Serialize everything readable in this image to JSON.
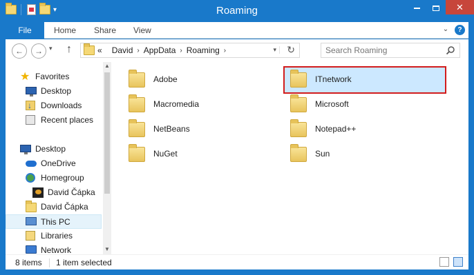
{
  "window": {
    "title": "Roaming"
  },
  "ribbon": {
    "tabs": [
      "File",
      "Home",
      "Share",
      "View"
    ],
    "help": "?"
  },
  "address": {
    "overflow": "«",
    "crumbs": [
      "David",
      "AppData",
      "Roaming"
    ]
  },
  "search": {
    "placeholder": "Search Roaming"
  },
  "navpane": {
    "favorites": [
      "Favorites",
      "Desktop",
      "Downloads",
      "Recent places"
    ],
    "tree": [
      "Desktop",
      "OneDrive",
      "Homegroup",
      "David Čápka",
      "David Čápka",
      "This PC",
      "Libraries",
      "Network"
    ],
    "selected": "This PC"
  },
  "files": [
    {
      "name": "Adobe",
      "selected": false
    },
    {
      "name": "ITnetwork",
      "selected": true
    },
    {
      "name": "Macromedia",
      "selected": false
    },
    {
      "name": "Microsoft",
      "selected": false
    },
    {
      "name": "NetBeans",
      "selected": false
    },
    {
      "name": "Notepad++",
      "selected": false
    },
    {
      "name": "NuGet",
      "selected": false
    },
    {
      "name": "Sun",
      "selected": false
    }
  ],
  "status": {
    "count": "8 items",
    "selection": "1 item selected"
  },
  "colors": {
    "accent": "#1979ca",
    "selection": "#cce8ff",
    "highlight": "#d21b1b",
    "close": "#c7463b"
  },
  "icons": {
    "qat": [
      "folder-icon",
      "properties-icon",
      "new-folder-icon"
    ],
    "nav": [
      "star-icon",
      "desktop-icon",
      "downloads-icon",
      "recent-places-icon",
      "desktop-icon",
      "onedrive-icon",
      "homegroup-icon",
      "user-icon",
      "user-folder-icon",
      "this-pc-icon",
      "libraries-icon",
      "network-icon"
    ]
  }
}
